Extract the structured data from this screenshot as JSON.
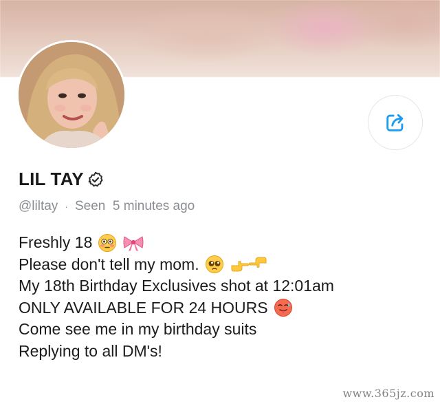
{
  "profile": {
    "display_name": "LIL TAY",
    "handle": "@liltay",
    "separator": "·",
    "seen_status": "Seen  5 minutes ago",
    "verified": true,
    "accent_color": "#1d9bf0"
  },
  "bio": {
    "lines": [
      {
        "text": "Freshly 18",
        "emojis": [
          "flushed-face-emoji",
          "pink-bow-emoji"
        ]
      },
      {
        "text": "Please don't tell my mom.",
        "emojis": [
          "pleading-face-emoji",
          "fingers-pointing-emoji"
        ]
      },
      {
        "text": "My 18th Birthday Exclusives shot at 12:01am",
        "emojis": []
      },
      {
        "text": "ONLY AVAILABLE FOR 24 HOURS",
        "emojis": [
          "hot-face-emoji"
        ]
      },
      {
        "text": "Come see me in my birthday suits",
        "emojis": []
      },
      {
        "text": "Replying to all DM's!",
        "emojis": []
      }
    ]
  },
  "actions": {
    "share_icon": "share-icon"
  },
  "watermark": "www.365jz.com"
}
